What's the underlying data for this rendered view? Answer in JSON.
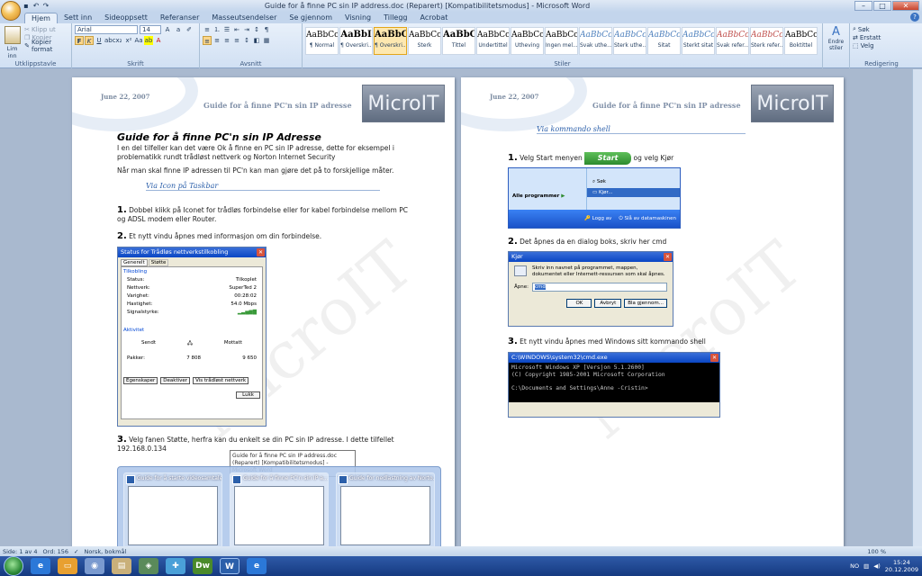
{
  "window": {
    "title": "Guide for å finne PC sin IP address.doc (Reparert) [Kompatibilitetsmodus] - Microsoft Word",
    "min": "–",
    "max": "□",
    "close": "✕"
  },
  "tabs": [
    "Hjem",
    "Sett inn",
    "Sideoppsett",
    "Referanser",
    "Masseutsendelser",
    "Se gjennom",
    "Visning",
    "Tillegg",
    "Acrobat"
  ],
  "ribbon": {
    "clipboard": {
      "paste": "Lim inn",
      "cut": "Klipp ut",
      "copy": "Kopier",
      "format_painter": "Kopier format",
      "label": "Utklippstavle"
    },
    "font": {
      "name": "Arial",
      "size": "14",
      "label": "Skrift"
    },
    "paragraph": {
      "label": "Avsnitt"
    },
    "styles": {
      "label": "Stiler",
      "items": [
        {
          "sample": "AaBbCcI",
          "name": "¶ Normal"
        },
        {
          "sample": "AaBbI",
          "name": "¶ Overskri..."
        },
        {
          "sample": "AaBbC",
          "name": "¶ Overskri..."
        },
        {
          "sample": "AaBbCcI",
          "name": "Sterk"
        },
        {
          "sample": "AaBbC",
          "name": "Tittel"
        },
        {
          "sample": "AaBbCcI",
          "name": "Undertittel"
        },
        {
          "sample": "AaBbCcI",
          "name": "Utheving"
        },
        {
          "sample": "AaBbCcDc",
          "name": "Ingen mel..."
        },
        {
          "sample": "AaBbCcI",
          "name": "Svak uthe..."
        },
        {
          "sample": "AaBbCcI",
          "name": "Sterk uthe..."
        },
        {
          "sample": "AaBbCcI",
          "name": "Sitat"
        },
        {
          "sample": "AaBbCcI",
          "name": "Sterkt sitat"
        },
        {
          "sample": "AaBbCc",
          "name": "Svak refer..."
        },
        {
          "sample": "AaBbCc",
          "name": "Sterk refer..."
        },
        {
          "sample": "AaBbCc",
          "name": "Boktittel"
        }
      ],
      "change_styles": "Endre stiler"
    },
    "editing": {
      "find": "Søk",
      "replace": "Erstatt",
      "select": "Velg",
      "label": "Redigering"
    }
  },
  "page1": {
    "date": "June 22, 2007",
    "header_title": "Guide for å finne PC'n sin IP adresse",
    "logo": "MicroIT",
    "heading": "Guide for å finne PC'n sin IP Adresse",
    "intro1": "I en del tilfeller kan det være Ok å finne en PC sin IP adresse, dette for eksempel i problematikk rundt trådløst nettverk og Norton Internet Security",
    "intro2": "Når man skal finne IP adressen til PC'n kan man gjøre det på to forskjellige måter.",
    "subhead": "Via Icon på Taskbar",
    "step1": "Dobbel klikk på Iconet     for trådløs forbindelse eller     for kabel forbindelse mellom PC og ADSL modem eller Router.",
    "step2": "Et nytt vindu åpnes med informasjon om din forbindelse.",
    "step3": "Velg fanen Støtte, herfra kan du enkelt se din PC sin IP adresse. I dette tilfellet 192.168.0.134",
    "status_dialog": {
      "title": "Status for Trådløs nettverkstilkobling",
      "tabs": [
        "Generelt",
        "Støtte"
      ],
      "section_conn": "Tilkobling",
      "rows": [
        {
          "k": "Status:",
          "v": "Tilkoplet"
        },
        {
          "k": "Nettverk:",
          "v": "SuperTed 2"
        },
        {
          "k": "Varighet:",
          "v": "00:28:02"
        },
        {
          "k": "Hastighet:",
          "v": "54.0 Mbps"
        },
        {
          "k": "Signalstyrke:",
          "v": ""
        }
      ],
      "section_activity": "Aktivitet",
      "sent": "Sendt",
      "received": "Mottatt",
      "packets_label": "Pakker:",
      "packets_sent": "7 808",
      "packets_recv": "9 650",
      "buttons": [
        "Egenskaper",
        "Deaktiver",
        "Vis trådløst nettverk"
      ],
      "close": "Lukk"
    }
  },
  "page2": {
    "date": "June 22, 2007",
    "header_title": "Guide for å finne PC'n sin IP adresse",
    "logo": "MicroIT",
    "subhead": "Via kommando shell",
    "step1": "Velg Start menyen",
    "step1b": "og velg Kjør",
    "start_label": "Start",
    "start_menu": {
      "all_programs": "Alle programmer",
      "search": "Søk",
      "run": "Kjør...",
      "logoff": "Logg av",
      "shutdown": "Slå av datamaskinen"
    },
    "step2": "Det åpnes da en dialog boks, skriv her cmd",
    "run_dialog": {
      "title": "Kjør",
      "desc": "Skriv inn navnet på programmet, mappen, dokumentet eller Internett-ressursen som skal åpnes.",
      "open_label": "Åpne:",
      "open_value": "cmd",
      "buttons": [
        "OK",
        "Avbryt",
        "Bla gjennom..."
      ]
    },
    "step3": "Et nytt vindu åpnes med Windows sitt kommando shell",
    "cmd_window": {
      "title": "C:\\WINDOWS\\system32\\cmd.exe",
      "lines": "Microsoft Windows XP [Versjon 5.1.2600]\n(C) Copyright 1985-2001 Microsoft Corporation\n\nC:\\Documents and Settings\\Anne -Cristin>"
    }
  },
  "watermark": "MicroIT",
  "statusbar": {
    "page": "Side: 1 av 4",
    "words": "Ord: 156",
    "language": "Norsk, bokmål",
    "zoom": "100 %"
  },
  "taskbar_popup": {
    "tooltip": "Guide for å finne PC sin IP address.doc (Reparert) [Kompatibilitetsmodus] - Microsoft Word",
    "thumbs": [
      {
        "title": "Guide for å starte videosamtale i..."
      },
      {
        "title": "Guide for å finne PC'n sin IP a..."
      },
      {
        "title": "Guide for nedlastning av Norto..."
      }
    ]
  },
  "tray": {
    "lang": "NO",
    "time": "15:24",
    "date": "20.12.2009"
  }
}
